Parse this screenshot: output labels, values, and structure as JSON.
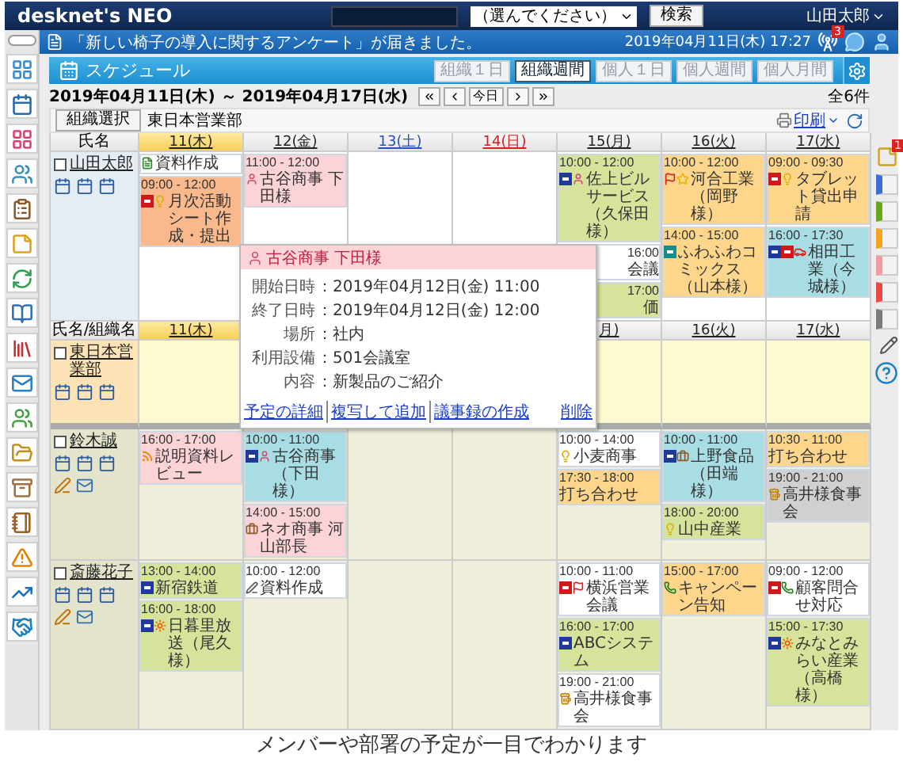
{
  "header": {
    "logo": "desknet's NEO",
    "search_scope": "（選んでください）",
    "search_button": "検索",
    "user": "山田太郎"
  },
  "notice": {
    "message": "「新しい椅子の導入に関するアンケート」が届きました。",
    "datetime": "2019年04月11日(木) 17:27",
    "badge": "3"
  },
  "schedule": {
    "title": "スケジュール",
    "views": [
      {
        "label": "組織１日",
        "selected": false
      },
      {
        "label": "組織週間",
        "selected": true
      },
      {
        "label": "個人１日",
        "selected": false
      },
      {
        "label": "個人週間",
        "selected": false
      },
      {
        "label": "個人月間",
        "selected": false
      }
    ],
    "range": "2019年04月11日(木) ～ 2019年04月17日(水)",
    "today_button": "今日",
    "count": "全6件",
    "org_button": "組織選択",
    "org_name": "東日本営業部",
    "print": "印刷"
  },
  "sections": [
    {
      "header": "氏名",
      "days": [
        {
          "label": "11(木)",
          "kind": "thu",
          "today": true
        },
        {
          "label": "12(金)",
          "kind": "fri",
          "today": false
        },
        {
          "label": "13(土)",
          "kind": "sat",
          "today": false
        },
        {
          "label": "14(日)",
          "kind": "sun",
          "today": false
        },
        {
          "label": "15(月)",
          "kind": "mon",
          "today": false
        },
        {
          "label": "16(火)",
          "kind": "tue",
          "today": false
        },
        {
          "label": "17(水)",
          "kind": "wed",
          "today": false
        }
      ],
      "rows": [
        {
          "kind": "self",
          "name": "山田太郎",
          "checked": false,
          "events": {
            "thu": [
              {
                "kind": "full",
                "title": "資料作成",
                "color": "#ffffff",
                "icons": [
                  {
                    "kind": "doc"
                  }
                ]
              },
              {
                "kind": "full",
                "time": "09:00 - 12:00",
                "title": "月次活動シート作成・提出",
                "color": "#f9b98c",
                "icons": [
                  {
                    "kind": "red"
                  },
                  {
                    "kind": "bulb"
                  }
                ]
              }
            ],
            "fri": [
              {
                "kind": "full",
                "time": "11:00 - 12:00",
                "title": "古谷商事 下田様",
                "color": "#fcd3d6",
                "icons": [
                  {
                    "kind": "person"
                  }
                ]
              }
            ],
            "mon": [
              {
                "kind": "full",
                "time": "10:00 - 12:00",
                "title": "佐上ビルサービス（久保田様）",
                "color": "#d5e39b",
                "icons": [
                  {
                    "kind": "out"
                  },
                  {
                    "kind": "person"
                  }
                ]
              },
              {
                "kind": "clipped",
                "time": "16:00",
                "title": "会議",
                "color": "#ffffff"
              },
              {
                "kind": "clipped",
                "time": "17:00",
                "title": "価",
                "color": "#d5e39b"
              }
            ],
            "tue": [
              {
                "kind": "full",
                "time": "10:00 - 12:00",
                "title": "河合工業（岡野様）",
                "color": "#fdd68c",
                "icons": [
                  {
                    "kind": "flag"
                  },
                  {
                    "kind": "star"
                  }
                ]
              },
              {
                "kind": "full",
                "time": "14:00 - 15:00",
                "title": "ふわふわコミックス（山本様）",
                "color": "#fdd68c",
                "icons": [
                  {
                    "kind": "tag2"
                  }
                ]
              }
            ],
            "wed": [
              {
                "kind": "full",
                "time": "09:00 - 09:30",
                "title": "タブレット貸出申請",
                "color": "#fdd68c",
                "icons": [
                  {
                    "kind": "red"
                  },
                  {
                    "kind": "bulb"
                  }
                ]
              },
              {
                "kind": "full",
                "time": "16:00 - 17:30",
                "title": "相田工業（今城様）",
                "color": "#a9dde4",
                "icons": [
                  {
                    "kind": "out"
                  },
                  {
                    "kind": "red"
                  },
                  {
                    "kind": "car"
                  }
                ]
              }
            ]
          }
        }
      ]
    },
    {
      "header": "氏名/組織名",
      "days": [
        {
          "label": "11(木)",
          "kind": "thu",
          "today": true
        },
        {
          "label": "月)",
          "kind": "mon",
          "today": false
        },
        {
          "label": "16(火)",
          "kind": "tue",
          "today": false
        },
        {
          "label": "17(水)",
          "kind": "wed",
          "today": false
        }
      ],
      "rows": [
        {
          "kind": "org",
          "name": "東日本営業部",
          "checked": false
        },
        {
          "kind": "member",
          "name": "鈴木誠",
          "checked": false,
          "events": {
            "thu": [
              {
                "kind": "full",
                "time": "16:00 - 17:00",
                "title": "説明資料レビュー",
                "color": "#fcd3d6",
                "icons": [
                  {
                    "kind": "feed"
                  }
                ]
              }
            ],
            "fri": [
              {
                "kind": "full",
                "time": "10:00 - 11:00",
                "title": "古谷商事（下田様）",
                "color": "#a9dde4",
                "icons": [
                  {
                    "kind": "out"
                  },
                  {
                    "kind": "person"
                  }
                ]
              },
              {
                "kind": "full",
                "time": "14:00 - 15:00",
                "title": "ネオ商事 河山部長",
                "color": "#fcd3d6",
                "icons": [
                  {
                    "kind": "bag"
                  }
                ]
              }
            ],
            "mon": [
              {
                "kind": "full",
                "time": "10:00 - 14:00",
                "title": "小麦商事",
                "color": "#ffffff",
                "icons": [
                  {
                    "kind": "bulb"
                  }
                ]
              },
              {
                "kind": "full",
                "time": "17:30 - 18:00",
                "title": "打ち合わせ",
                "color": "#fdd68c"
              }
            ],
            "tue": [
              {
                "kind": "full",
                "time": "10:00 - 11:00",
                "title": "上野食品（田端様）",
                "color": "#a9dde4",
                "icons": [
                  {
                    "kind": "out"
                  },
                  {
                    "kind": "bag"
                  }
                ]
              },
              {
                "kind": "full",
                "time": "18:00 - 20:00",
                "title": "山中産業",
                "color": "#d5e39b",
                "icons": [
                  {
                    "kind": "bulb"
                  }
                ]
              }
            ],
            "wed": [
              {
                "kind": "full",
                "time": "10:30 - 11:00",
                "title": "打ち合わせ",
                "color": "#fdd68c"
              },
              {
                "kind": "full",
                "time": "19:00 - 21:00",
                "title": "高井様食事会",
                "color": "#d0d0d0",
                "icons": [
                  {
                    "kind": "beer"
                  }
                ]
              }
            ]
          }
        },
        {
          "kind": "member",
          "name": "斎藤花子",
          "checked": false,
          "events": {
            "thu": [
              {
                "kind": "full",
                "time": "13:00 - 14:00",
                "title": "新宿鉄道",
                "color": "#d5e39b",
                "icons": [
                  {
                    "kind": "out"
                  }
                ]
              },
              {
                "kind": "full",
                "time": "16:00 - 18:00",
                "title": "日暮里放送（尾久様）",
                "color": "#d5e39b",
                "icons": [
                  {
                    "kind": "out"
                  },
                  {
                    "kind": "sun"
                  }
                ]
              }
            ],
            "fri": [
              {
                "kind": "full",
                "time": "10:00 - 12:00",
                "title": "資料作成",
                "color": "#ffffff",
                "icons": [
                  {
                    "kind": "pen"
                  }
                ]
              }
            ],
            "mon": [
              {
                "kind": "full",
                "time": "10:00 - 11:00",
                "title": "横浜営業会議",
                "color": "#ffffff",
                "icons": [
                  {
                    "kind": "red"
                  },
                  {
                    "kind": "flag"
                  }
                ]
              },
              {
                "kind": "full",
                "time": "16:00 - 17:00",
                "title": "ABCシステム",
                "color": "#d5e39b",
                "icons": [
                  {
                    "kind": "out"
                  }
                ]
              },
              {
                "kind": "full",
                "time": "19:00 - 21:00",
                "title": "高井様食事会",
                "color": "#ffffff",
                "icons": [
                  {
                    "kind": "beer"
                  }
                ]
              }
            ],
            "tue": [
              {
                "kind": "full",
                "time": "15:00 - 17:00",
                "title": "キャンペーン告知",
                "color": "#fdd68c",
                "icons": [
                  {
                    "kind": "phone"
                  }
                ]
              }
            ],
            "wed": [
              {
                "kind": "full",
                "time": "09:00 - 12:00",
                "title": "顧客問合せ対応",
                "color": "#ffffff",
                "icons": [
                  {
                    "kind": "red"
                  },
                  {
                    "kind": "phone"
                  }
                ]
              },
              {
                "kind": "full",
                "time": "15:00 - 17:30",
                "title": "みなとみらい産業（高橋様）",
                "color": "#d5e39b",
                "icons": [
                  {
                    "kind": "out"
                  },
                  {
                    "kind": "sun"
                  }
                ]
              }
            ]
          }
        }
      ]
    }
  ],
  "popup": {
    "title": "古谷商事 下田様",
    "fields": [
      {
        "label": "開始日時",
        "value": "：2019年04月12日(金) 11:00"
      },
      {
        "label": "終了日時",
        "value": "：2019年04月12日(金) 12:00"
      },
      {
        "label": "場所",
        "value": "：社内"
      },
      {
        "label": "利用設備",
        "value": "：501会議室"
      },
      {
        "label": "内容",
        "value": "：新製品のご紹介"
      }
    ],
    "links": [
      "予定の詳細",
      "複写して追加",
      "議事録の作成"
    ],
    "delete": "削除"
  },
  "side": {
    "badge": "1",
    "tabs": [
      {
        "color": "#3b6fd6"
      },
      {
        "color": "#6aa51e"
      },
      {
        "color": "#f7a21d"
      },
      {
        "color": "#f59aa0"
      },
      {
        "color": "#e84848"
      },
      {
        "color": "#7a7a7a"
      }
    ]
  },
  "caption": "メンバーや部署の予定が一目でわかります"
}
